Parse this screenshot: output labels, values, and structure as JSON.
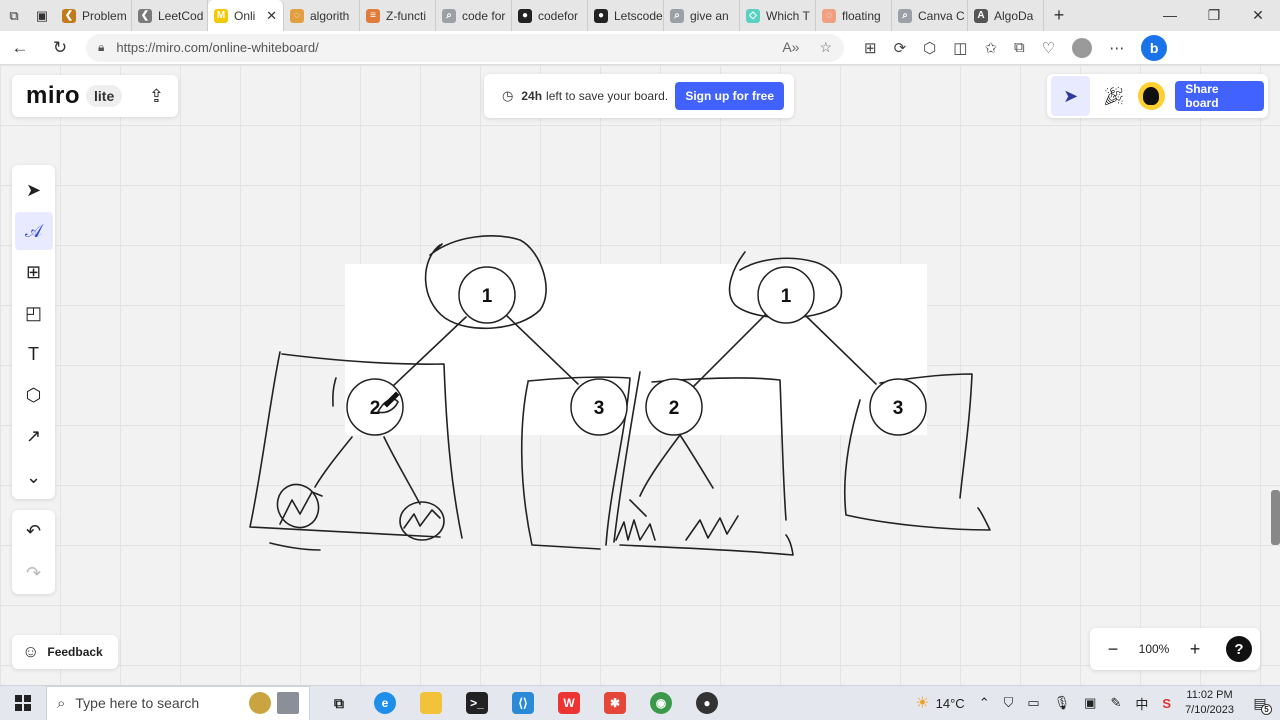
{
  "browser": {
    "tabs": [
      {
        "label": "Problem",
        "color": "#c07a1a",
        "glyph": "❮"
      },
      {
        "label": "LeetCod",
        "color": "#7a7a7a",
        "glyph": "❮"
      },
      {
        "label": "Onli",
        "color": "#f5c900",
        "glyph": "M",
        "active": true
      },
      {
        "label": "algorith",
        "color": "#e0a040",
        "glyph": "◌"
      },
      {
        "label": "Z-functi",
        "color": "#e07b39",
        "glyph": "≡"
      },
      {
        "label": "code for",
        "color": "#9aa0a6",
        "glyph": "⌕"
      },
      {
        "label": "codefor",
        "color": "#222222",
        "glyph": "●"
      },
      {
        "label": "Letscode",
        "color": "#222222",
        "glyph": "●"
      },
      {
        "label": "give an",
        "color": "#9aa0a6",
        "glyph": "⌕"
      },
      {
        "label": "Which T",
        "color": "#5ad1c1",
        "glyph": "◇"
      },
      {
        "label": "floating",
        "color": "#f0a080",
        "glyph": "◌"
      },
      {
        "label": "Canva C",
        "color": "#9aa0a6",
        "glyph": "⌕"
      },
      {
        "label": "AlgoDa",
        "color": "#555555",
        "glyph": "A"
      }
    ],
    "new_tab": "+",
    "url": "https://miro.com/online-whiteboard/"
  },
  "miro": {
    "logo": "miro",
    "badge": "lite",
    "save_bold": "24h",
    "save_text": "left to save your board.",
    "signup_label": "Sign up for free",
    "share_label": "Share board",
    "feedback_label": "Feedback",
    "zoom": "100%",
    "zoom_out": "−",
    "zoom_in": "+",
    "help": "?"
  },
  "diagram": {
    "nodes": [
      "1",
      "2",
      "3",
      "1",
      "2",
      "3"
    ]
  },
  "taskbar": {
    "search_placeholder": "Type here to search",
    "temperature": "14°C",
    "time": "11:02 PM",
    "date": "7/10/2023",
    "notifications": "5"
  }
}
